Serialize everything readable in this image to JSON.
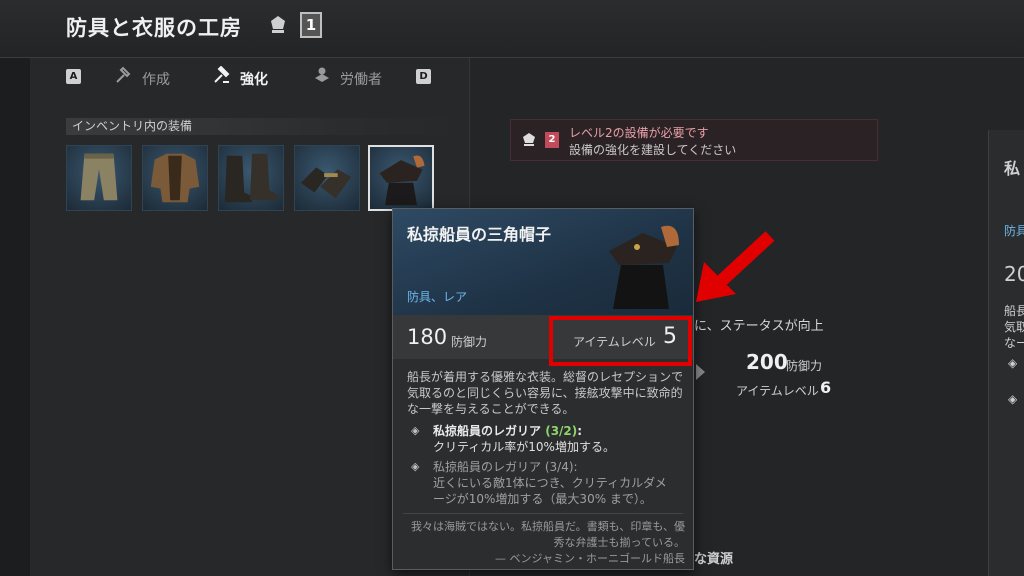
{
  "header": {
    "title": "防具と衣服の工房",
    "level": "1"
  },
  "tabs": [
    {
      "key": "A"
    },
    {
      "label": "作成",
      "icon": "craft-icon"
    },
    {
      "label": "強化",
      "icon": "upgrade-hammer-icon",
      "active": true
    },
    {
      "label": "労働者",
      "icon": "worker-icon"
    },
    {
      "key": "D"
    }
  ],
  "inventory": {
    "label": "インベントリ内の装備",
    "slots": [
      "pants",
      "shirt-vest",
      "boots",
      "gloves",
      "tricorn-hat"
    ]
  },
  "requirement": {
    "badge": "2",
    "line1": "レベル2の設備が必要です",
    "line2": "設備の強化を建設してください"
  },
  "upgrade": {
    "stat_up_text": "に、ステータスが向上",
    "next_defense": "200",
    "defense_unit": "防御力",
    "next_level_label": "アイテムレベル",
    "next_level": "6",
    "resources_label": "な資源"
  },
  "right_card": {
    "title": "私",
    "sub": "防具",
    "value": "20",
    "desc1": "船長",
    "desc2": "気取",
    "desc3": "なー"
  },
  "tooltip": {
    "name": "私掠船員の三角帽子",
    "type": "防具、レア",
    "defense": "180",
    "defense_unit": "防御力",
    "item_level_label": "アイテムレベル",
    "item_level": "5",
    "description": "船長が着用する優雅な衣装。総督のレセプションで気取るのと同じくらい容易に、接舷攻撃中に致命的な一撃を与えることができる。",
    "set_bonuses": [
      {
        "name": "私掠船員のレガリア",
        "count": "(3/2)",
        "colon": ":",
        "desc": "クリティカル率が10%増加する。",
        "active": true
      },
      {
        "name": "私掠船員のレガリア",
        "count": "(3/4)",
        "colon": ":",
        "desc": "近くにいる敵1体につき、クリティカルダメージが10%増加する（最大30% まで）。",
        "active": false
      }
    ],
    "quote": "我々は海賊ではない。私掠船員だ。書類も、印章も、優秀な弁護士も揃っている。",
    "quote_author": "— ベンジャミン・ホーニゴールド船長"
  },
  "colors": {
    "annotation": "#e00000",
    "set_active_count": "#8fd36a",
    "type_text": "#6fb8ec",
    "requirement_text": "#e8a0a8"
  }
}
